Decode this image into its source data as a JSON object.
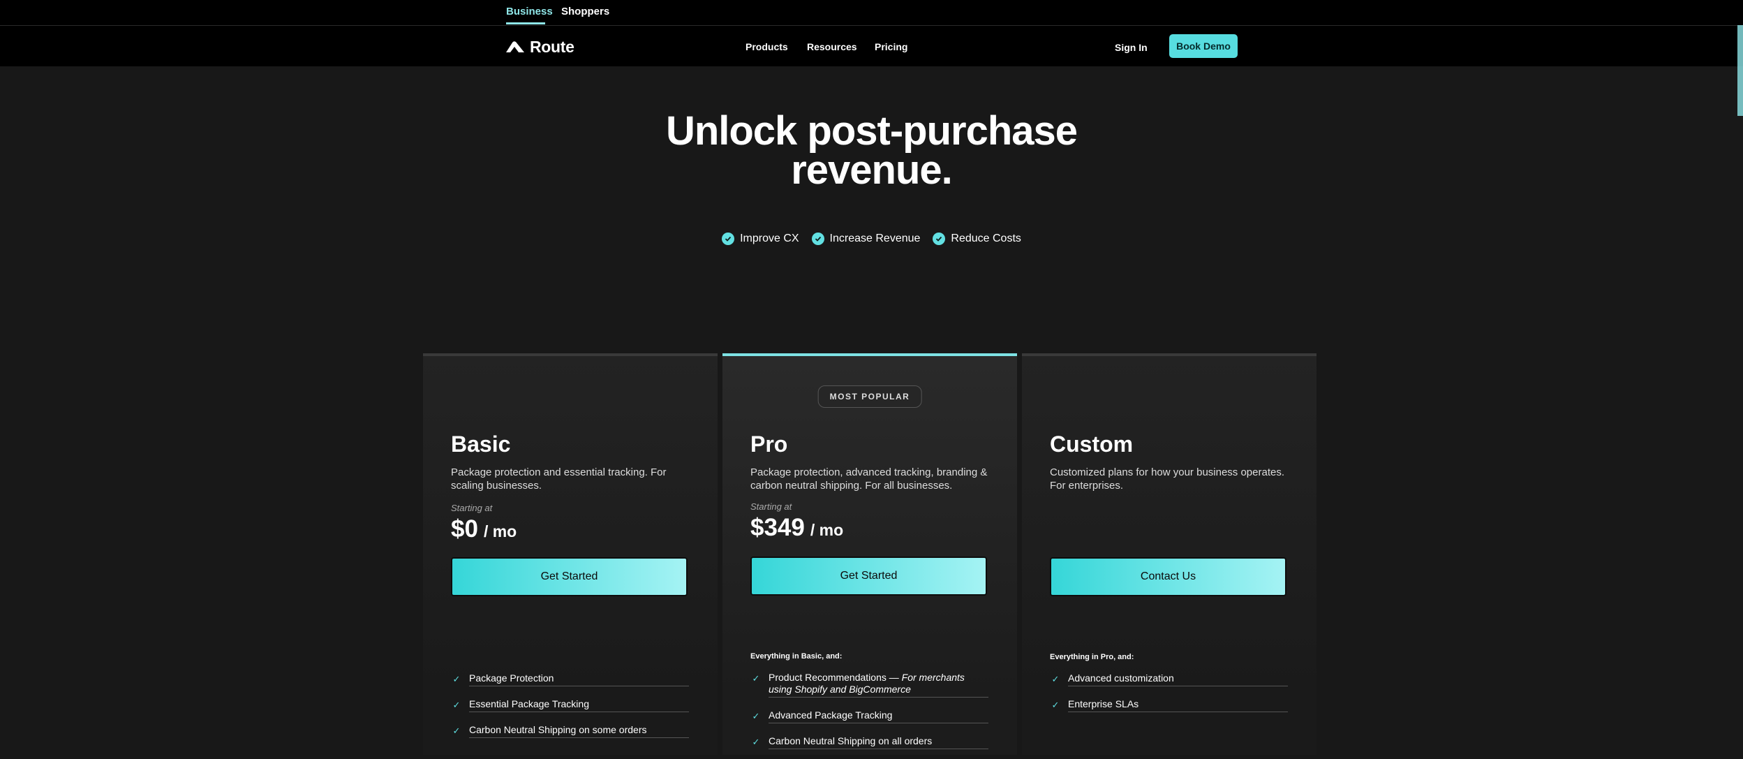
{
  "topbar": {
    "tabs": [
      {
        "label": "Business",
        "active": true
      },
      {
        "label": "Shoppers",
        "active": false
      }
    ]
  },
  "nav": {
    "brand": "Route",
    "links": [
      "Products",
      "Resources",
      "Pricing"
    ],
    "sign_in": "Sign In",
    "book_demo": "Book Demo"
  },
  "hero": {
    "title_line1": "Unlock post-purchase",
    "title_line2": "revenue.",
    "badges": [
      "Improve CX",
      "Increase Revenue",
      "Reduce Costs"
    ]
  },
  "plans": [
    {
      "name": "Basic",
      "description": "Package protection and essential tracking. For scaling businesses.",
      "starting_label": "Starting at",
      "price": "$0",
      "period": "/ mo",
      "cta": "Get Started",
      "features_intro": "",
      "features": [
        "Package Protection",
        "Essential Package Tracking",
        "Carbon Neutral Shipping on some orders"
      ]
    },
    {
      "name": "Pro",
      "badge": "MOST POPULAR",
      "description": "Package protection, advanced tracking, branding & carbon neutral shipping. For all businesses.",
      "starting_label": "Starting at",
      "price": "$349",
      "period": "/ mo",
      "cta": "Get Started",
      "features_intro": "Everything in Basic, and:",
      "feature_1_main": "Product Recommendations —",
      "feature_1_note": "For merchants using Shopify and BigCommerce",
      "features": [
        "Advanced Package Tracking",
        "Carbon Neutral Shipping on all orders"
      ]
    },
    {
      "name": "Custom",
      "description": "Customized plans for how your business operates. For enterprises.",
      "cta": "Contact Us",
      "features_intro": "Everything in Pro, and:",
      "features": [
        "Advanced customization",
        "Enterprise SLAs"
      ]
    }
  ],
  "colors": {
    "accent": "#57dde0",
    "background": "#181818",
    "nav": "#000000"
  }
}
